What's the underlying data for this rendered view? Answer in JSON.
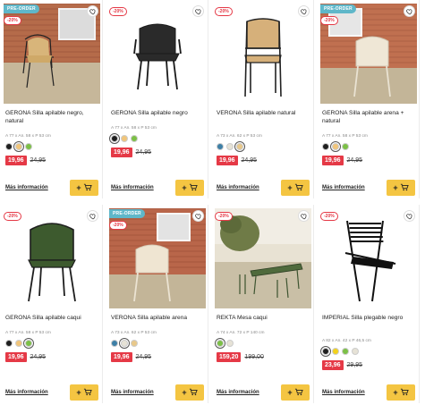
{
  "products": [
    {
      "badge_pre": "PRE-ORDER",
      "discount": "-20%",
      "title": "GERONA Silla apilable negro, natural",
      "dims": "A 77 x An. 58 x P 53 cm",
      "colors": [
        "#1f1f1f",
        "#f1c57a",
        "#7cc046"
      ],
      "selected": 1,
      "price": "19,96",
      "old_price": "24,95",
      "info": "Más información"
    },
    {
      "badge_pre": "",
      "discount": "-20%",
      "title": "GERONA Silla apilable negro",
      "dims": "A 77 x An. 58 x P 53 cm",
      "colors": [
        "#1f1f1f",
        "#f1c57a",
        "#7cc046"
      ],
      "selected": 0,
      "price": "19,96",
      "old_price": "24,95",
      "info": "Más información"
    },
    {
      "badge_pre": "",
      "discount": "-20%",
      "title": "VERONA Silla apilable natural",
      "dims": "A 73 x An. 62 x P 53 cm",
      "colors": [
        "#3d7fa6",
        "#e6e2d6",
        "#e8c88a"
      ],
      "selected": 2,
      "price": "19,96",
      "old_price": "24,95",
      "info": "Más información"
    },
    {
      "badge_pre": "PRE-ORDER",
      "discount": "-20%",
      "title": "GERONA Silla apilable arena + natural",
      "dims": "A 77 x An. 58 x P 53 cm",
      "colors": [
        "#1f1f1f",
        "#f1c57a",
        "#7cc046"
      ],
      "selected": 1,
      "price": "19,96",
      "old_price": "24,95",
      "info": "Más información"
    },
    {
      "badge_pre": "",
      "discount": "-20%",
      "title": "GERONA Silla apilable caqui",
      "dims": "A 77 x An. 58 x P 53 cm",
      "colors": [
        "#1f1f1f",
        "#f1c57a",
        "#7cc046"
      ],
      "selected": 2,
      "price": "19,96",
      "old_price": "24,95",
      "info": "Más información"
    },
    {
      "badge_pre": "PRE-ORDER",
      "discount": "-20%",
      "title": "VERONA Silla apilable arena",
      "dims": "A 73 x An. 62 x P 53 cm",
      "colors": [
        "#3d7fa6",
        "#e6e2d6",
        "#e8c88a"
      ],
      "selected": 1,
      "price": "19,96",
      "old_price": "24,95",
      "info": "Más información"
    },
    {
      "badge_pre": "",
      "discount": "-20%",
      "title": "REKTA Mesa caqui",
      "dims": "A 74 x An. 72 x P 140 cm",
      "colors": [
        "#7cc046",
        "#e6e2d6"
      ],
      "selected": 0,
      "price": "159,20",
      "old_price": "199,00",
      "info": "Más información"
    },
    {
      "badge_pre": "",
      "discount": "-20%",
      "title": "IMPERIAL Silla plegable negro",
      "dims": "A 82 x An. 42 x P 46,5 cm",
      "colors": [
        "#1f1f1f",
        "#f2d21b",
        "#7cc046",
        "#e6e2d6"
      ],
      "selected": 0,
      "price": "23,96",
      "old_price": "29,95",
      "info": "Más información"
    }
  ],
  "cart_plus": "+",
  "icons": {
    "favorite": "heart-outline-icon",
    "cart": "cart-icon"
  },
  "accent": "#f4c542",
  "price_color": "#e53946"
}
